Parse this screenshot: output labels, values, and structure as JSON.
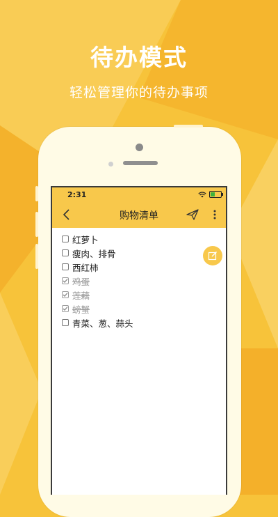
{
  "promo": {
    "title": "待办模式",
    "subtitle": "轻松管理你的待办事项"
  },
  "status_bar": {
    "time": "2:31",
    "icons": [
      "wifi-icon",
      "battery-icon"
    ]
  },
  "navbar": {
    "title": "购物清单",
    "back_icon": "chevron-left-icon",
    "send_icon": "paper-plane-icon",
    "more_icon": "more-vertical-icon"
  },
  "todo_items": [
    {
      "label": "红萝卜",
      "checked": false
    },
    {
      "label": "瘦肉、排骨",
      "checked": false
    },
    {
      "label": "西红柿",
      "checked": false
    },
    {
      "label": "鸡蛋",
      "checked": true
    },
    {
      "label": "莲藕",
      "checked": true
    },
    {
      "label": "螃蟹",
      "checked": true
    },
    {
      "label": "青菜、葱、蒜头",
      "checked": false
    }
  ],
  "fab": {
    "icon": "edit-icon"
  },
  "colors": {
    "background": "#f7c33a",
    "accent": "#f8c84b",
    "checked_text": "#9a9a9a"
  }
}
